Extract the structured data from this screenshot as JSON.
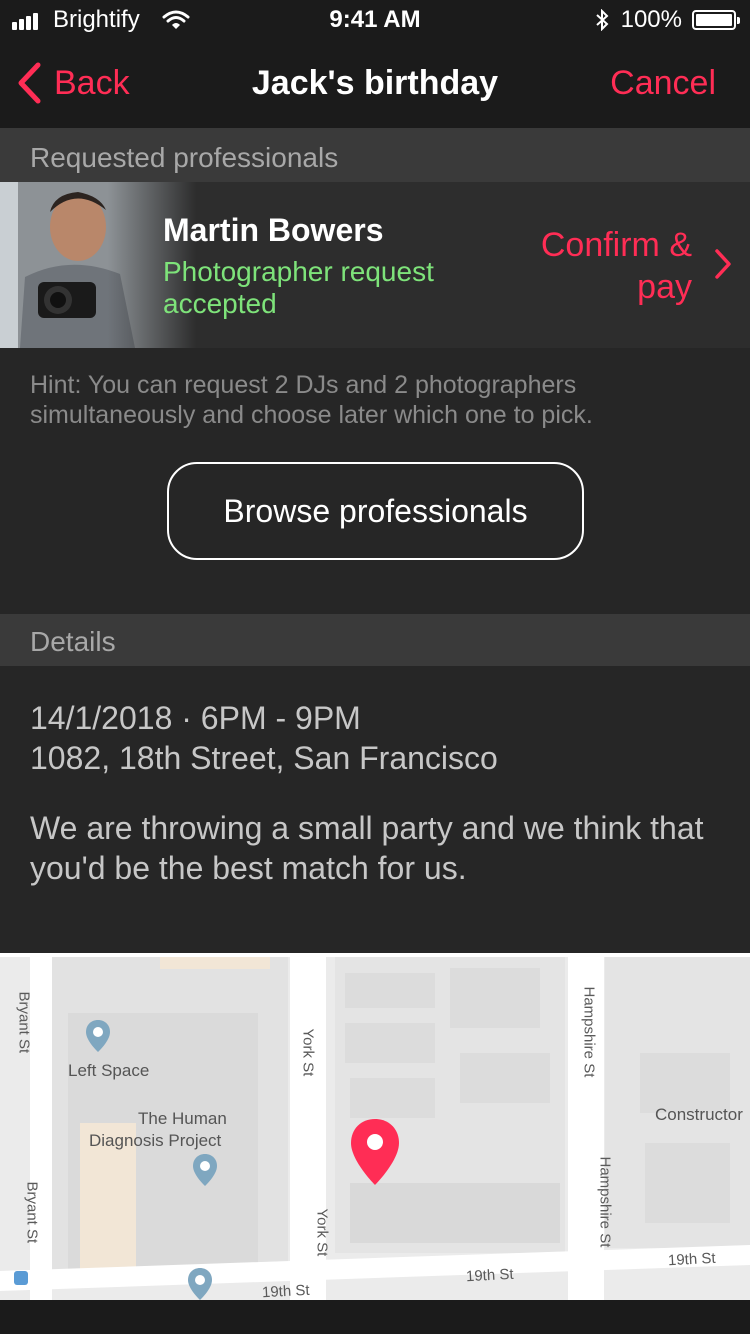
{
  "status_bar": {
    "carrier": "Brightify",
    "time": "9:41 AM",
    "battery": "100%"
  },
  "nav": {
    "back_label": "Back",
    "title": "Jack's birthday",
    "cancel_label": "Cancel"
  },
  "requested": {
    "header": "Requested professionals",
    "professional": {
      "name": "Martin Bowers",
      "status": "Photographer request accepted",
      "action": "Confirm & pay"
    },
    "hint": "Hint: You can request 2 DJs and 2 photographers simultaneously and choose later which one to pick.",
    "browse_label": "Browse professionals"
  },
  "details": {
    "header": "Details",
    "datetime": "14/1/2018 · 6PM - 9PM",
    "address": "1082, 18th Street, San Francisco",
    "description": "We are throwing a small party and we think that you'd be the best match for us."
  },
  "map": {
    "labels": {
      "left_space": "Left Space",
      "human_dx_1": "The Human",
      "human_dx_2": "Diagnosis Project",
      "constructor": "Constructor",
      "bryant_1": "Bryant St",
      "bryant_2": "Bryant St",
      "york_1": "York St",
      "york_2": "York St",
      "hampshire_1": "Hampshire St",
      "hampshire_2": "Hampshire St",
      "nineteenth_1": "19th St",
      "nineteenth_2": "19th St",
      "nineteenth_3": "19th St"
    }
  },
  "colors": {
    "accent": "#ff2d55",
    "success": "#7ee37a",
    "background": "#262626"
  }
}
